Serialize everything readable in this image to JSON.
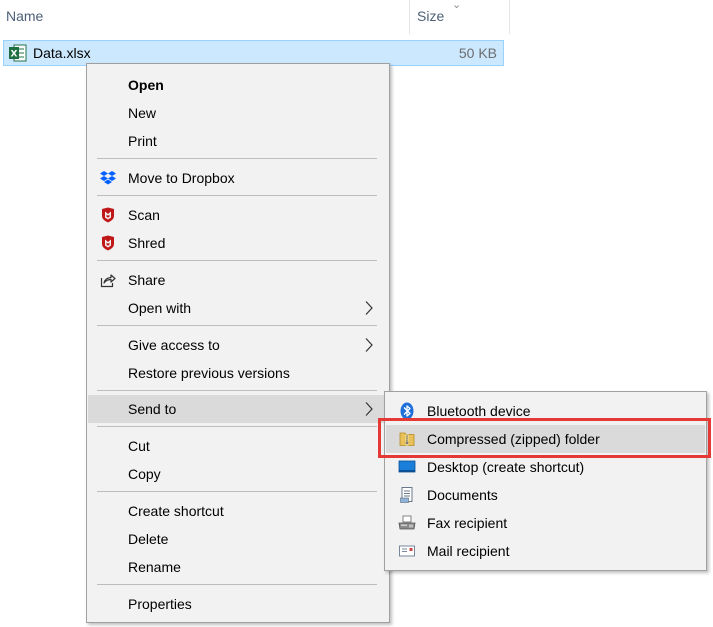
{
  "columns": {
    "name": "Name",
    "size": "Size"
  },
  "file": {
    "name": "Data.xlsx",
    "size": "50 KB",
    "icon": "excel-file-icon"
  },
  "menu": {
    "open": "Open",
    "new": "New",
    "print": "Print",
    "move_to_dropbox": "Move to Dropbox",
    "scan": "Scan",
    "shred": "Shred",
    "share": "Share",
    "open_with": "Open with",
    "give_access_to": "Give access to",
    "restore_previous_versions": "Restore previous versions",
    "send_to": "Send to",
    "cut": "Cut",
    "copy": "Copy",
    "create_shortcut": "Create shortcut",
    "delete": "Delete",
    "rename": "Rename",
    "properties": "Properties"
  },
  "submenu": {
    "bluetooth": "Bluetooth device",
    "compressed": "Compressed (zipped) folder",
    "desktop": "Desktop (create shortcut)",
    "documents": "Documents",
    "fax": "Fax recipient",
    "mail": "Mail recipient"
  },
  "colors": {
    "selection": "#cce8ff",
    "menu_bg": "#f2f2f2",
    "hover": "#dadada",
    "highlight": "#e53935",
    "dropbox": "#0061fe",
    "mcafee": "#c01818"
  }
}
